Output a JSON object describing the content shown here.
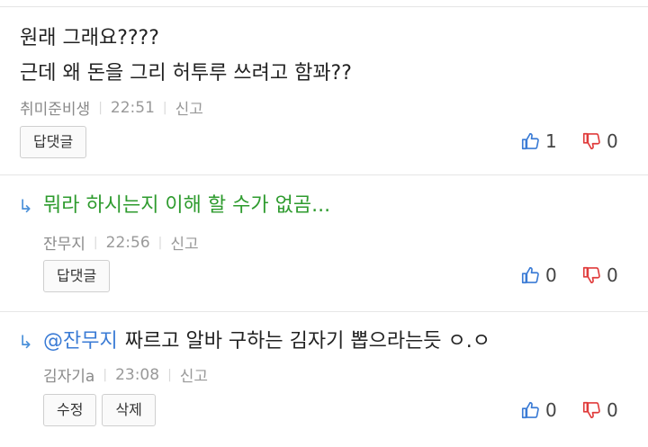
{
  "comments": [
    {
      "lines": [
        "원래 그래요????",
        "근데 왜 돈을 그리 허투루 쓰려고 함꽈??"
      ],
      "author": "취미준비생",
      "time": "22:51",
      "report": "신고",
      "buttons": [
        "답댓글"
      ],
      "up": "1",
      "down": "0"
    },
    {
      "text": "뭐라 하시는지 이해 할 수가 없곰...",
      "author": "잔무지",
      "time": "22:56",
      "report": "신고",
      "buttons": [
        "답댓글"
      ],
      "up": "0",
      "down": "0"
    },
    {
      "mention": "@잔무지",
      "text": "짜르고 알바 구하는 김자기 뽑으라는듯 ㅇ.ㅇ",
      "author": "김자기a",
      "time": "23:08",
      "report": "신고",
      "buttons": [
        "수정",
        "삭제"
      ],
      "up": "0",
      "down": "0"
    }
  ],
  "icons": {
    "reply_arrow": "reply-arrow-icon",
    "thumbs_up": "thumbs-up-icon",
    "thumbs_down": "thumbs-down-icon"
  },
  "colors": {
    "thumbs_up": "#3a7bd5",
    "thumbs_down": "#e03c3c",
    "reply_text": "#2e9b2e",
    "mention": "#3a7bd5"
  }
}
